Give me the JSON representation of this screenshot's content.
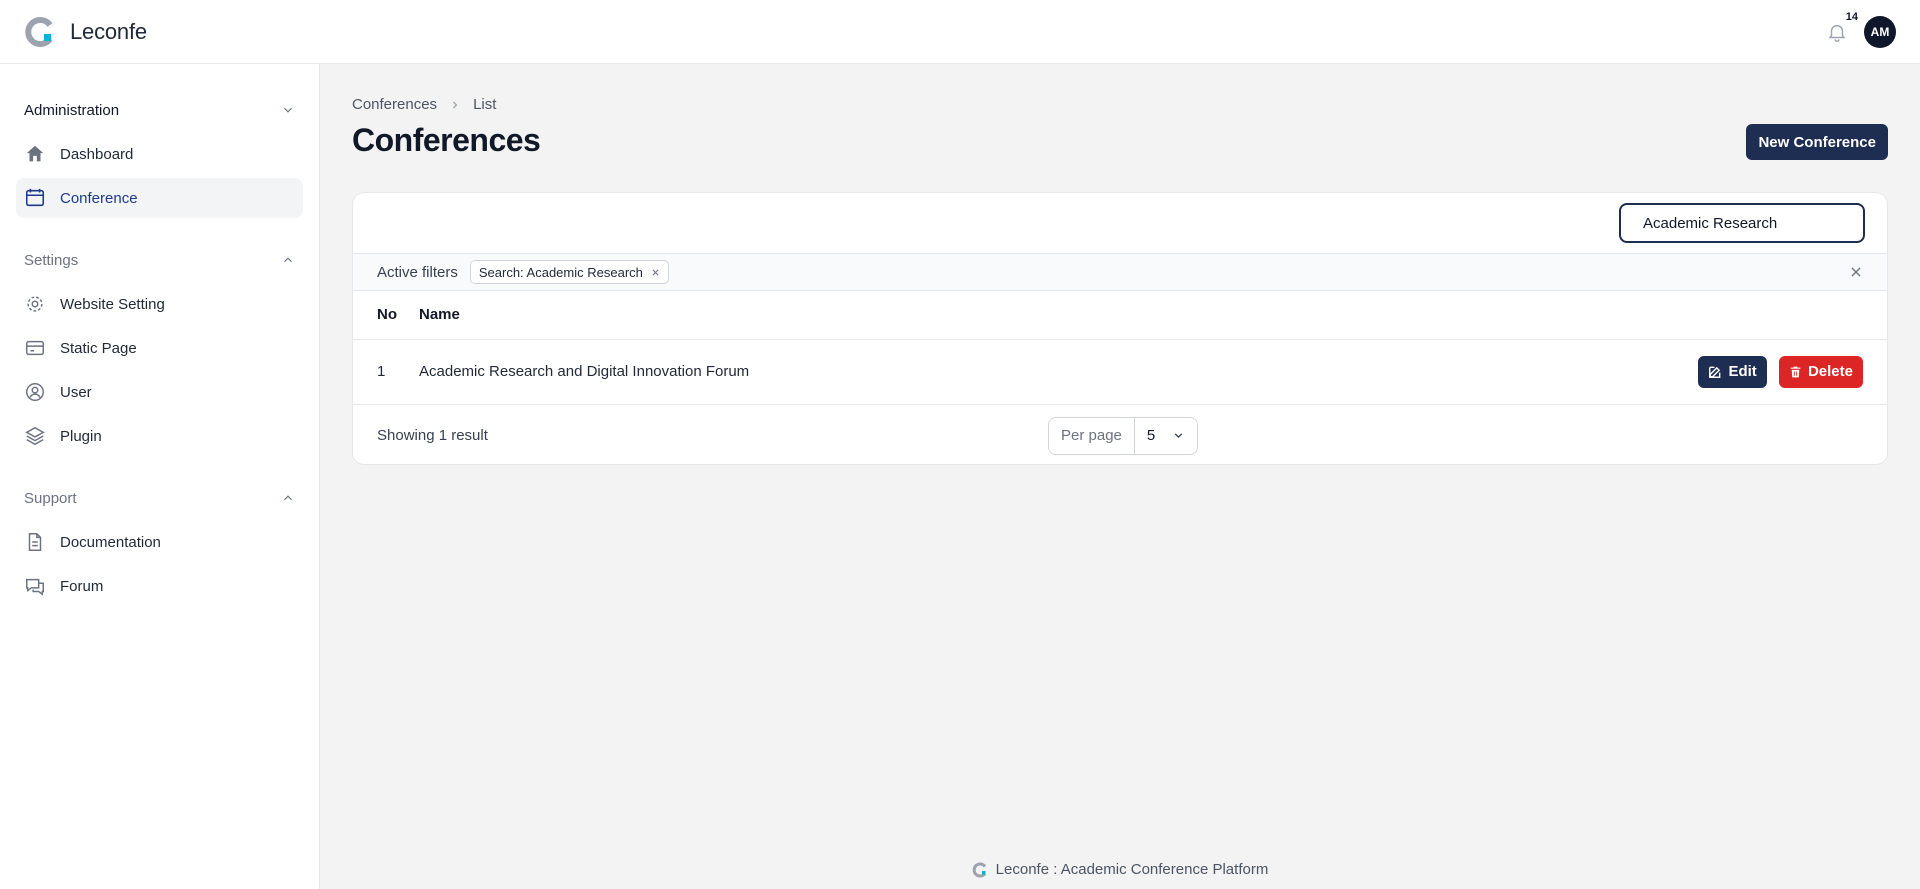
{
  "app": {
    "name": "Leconfe",
    "brand_color": "#1e2d52",
    "danger_color": "#dc2626",
    "accent": "#06b6d4"
  },
  "topbar": {
    "notification_count": "14",
    "avatar_initials": "AM"
  },
  "sidebar": {
    "groups": [
      {
        "label": "Administration",
        "items": [
          {
            "label": "Dashboard",
            "icon": "home-icon"
          },
          {
            "label": "Conference",
            "icon": "calendar-icon",
            "active": true
          }
        ]
      },
      {
        "label": "Settings",
        "items": [
          {
            "label": "Website Setting",
            "icon": "gear-icon"
          },
          {
            "label": "Static Page",
            "icon": "credit-card-icon"
          },
          {
            "label": "User",
            "icon": "user-circle-icon"
          },
          {
            "label": "Plugin",
            "icon": "layers-icon"
          }
        ]
      },
      {
        "label": "Support",
        "items": [
          {
            "label": "Documentation",
            "icon": "document-icon"
          },
          {
            "label": "Forum",
            "icon": "chat-icon"
          }
        ]
      }
    ]
  },
  "breadcrumb": [
    "Conferences",
    "List"
  ],
  "page": {
    "title": "Conferences",
    "new_button": "New Conference"
  },
  "search": {
    "value": "Academic Research"
  },
  "filters": {
    "label": "Active filters",
    "chip": "Search: Academic Research"
  },
  "table": {
    "headers": [
      "No",
      "Name"
    ],
    "rows": [
      {
        "no": "1",
        "name": "Academic Research and Digital Innovation Forum"
      }
    ],
    "edit_label": "Edit",
    "delete_label": "Delete"
  },
  "pagination": {
    "result_text": "Showing 1 result",
    "per_page_label": "Per page",
    "per_page_value": "5"
  },
  "footer": {
    "text": "Leconfe : Academic Conference Platform"
  }
}
